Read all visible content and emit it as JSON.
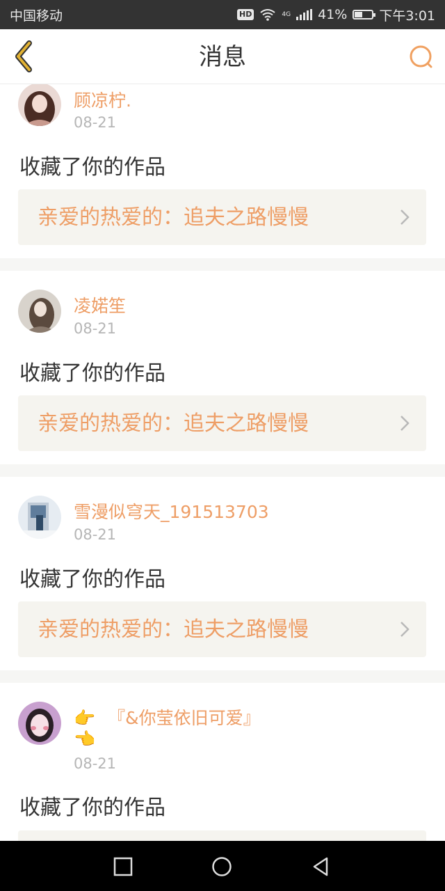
{
  "status_bar": {
    "carrier": "中国移动",
    "hd": "HD",
    "network": "4G",
    "battery": "41%",
    "time": "下午3:01"
  },
  "header": {
    "title": "消息"
  },
  "messages": [
    {
      "name": "顾凉柠.",
      "date": "08-21",
      "action": "收藏了你的作品",
      "work": "亲爱的热爱的：追夫之路慢慢"
    },
    {
      "name": "凌婼笙",
      "date": "08-21",
      "action": "收藏了你的作品",
      "work": "亲爱的热爱的：追夫之路慢慢"
    },
    {
      "name": "雪漫似穹天_191513703",
      "date": "08-21",
      "action": "收藏了你的作品",
      "work": "亲爱的热爱的：追夫之路慢慢"
    },
    {
      "name_emoji_1": "👉",
      "name": "『&你莹依旧可爱』",
      "name_emoji_2": "👈",
      "date": "08-21",
      "action": "收藏了你的作品"
    }
  ],
  "colors": {
    "accent": "#ee9e66",
    "back_icon": "#d9a323",
    "status_bar_bg": "#333333"
  }
}
